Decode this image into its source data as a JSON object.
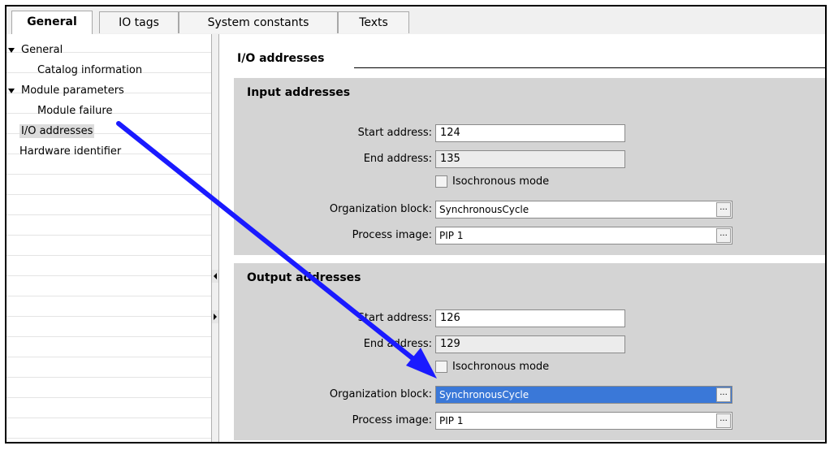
{
  "tabs": [
    {
      "label": "General",
      "active": true
    },
    {
      "label": "IO tags",
      "active": false
    },
    {
      "label": "System constants",
      "active": false
    },
    {
      "label": "Texts",
      "active": false
    }
  ],
  "tree": {
    "items": [
      {
        "label": "General",
        "expanded": true,
        "level": 0
      },
      {
        "label": "Catalog information",
        "level": 1
      },
      {
        "label": "Module parameters",
        "expanded": true,
        "level": 0
      },
      {
        "label": "Module failure",
        "level": 1
      },
      {
        "label": "I/O addresses",
        "level": 0,
        "selected": true
      },
      {
        "label": "Hardware identifier",
        "level": 0
      }
    ]
  },
  "section": {
    "title": "I/O addresses"
  },
  "input": {
    "title": "Input addresses",
    "start_label": "Start address:",
    "start_value": "124",
    "end_label": "End address:",
    "end_value": "135",
    "isochronous_label": "Isochronous mode",
    "isochronous_checked": false,
    "ob_label": "Organization block:",
    "ob_value": "SynchronousCycle",
    "pi_label": "Process image:",
    "pi_value": "PIP 1",
    "browse": "..."
  },
  "output": {
    "title": "Output addresses",
    "start_label": "Start address:",
    "start_value": "126",
    "end_label": "End address:",
    "end_value": "129",
    "isochronous_label": "Isochronous mode",
    "isochronous_checked": false,
    "ob_label": "Organization block:",
    "ob_value": "SynchronousCycle",
    "pi_label": "Process image:",
    "pi_value": "PIP 1",
    "browse": "..."
  },
  "colors": {
    "panel_bg": "#d4d4d4",
    "selection": "#3a78d8",
    "annotation_arrow": "#1a1aff"
  }
}
